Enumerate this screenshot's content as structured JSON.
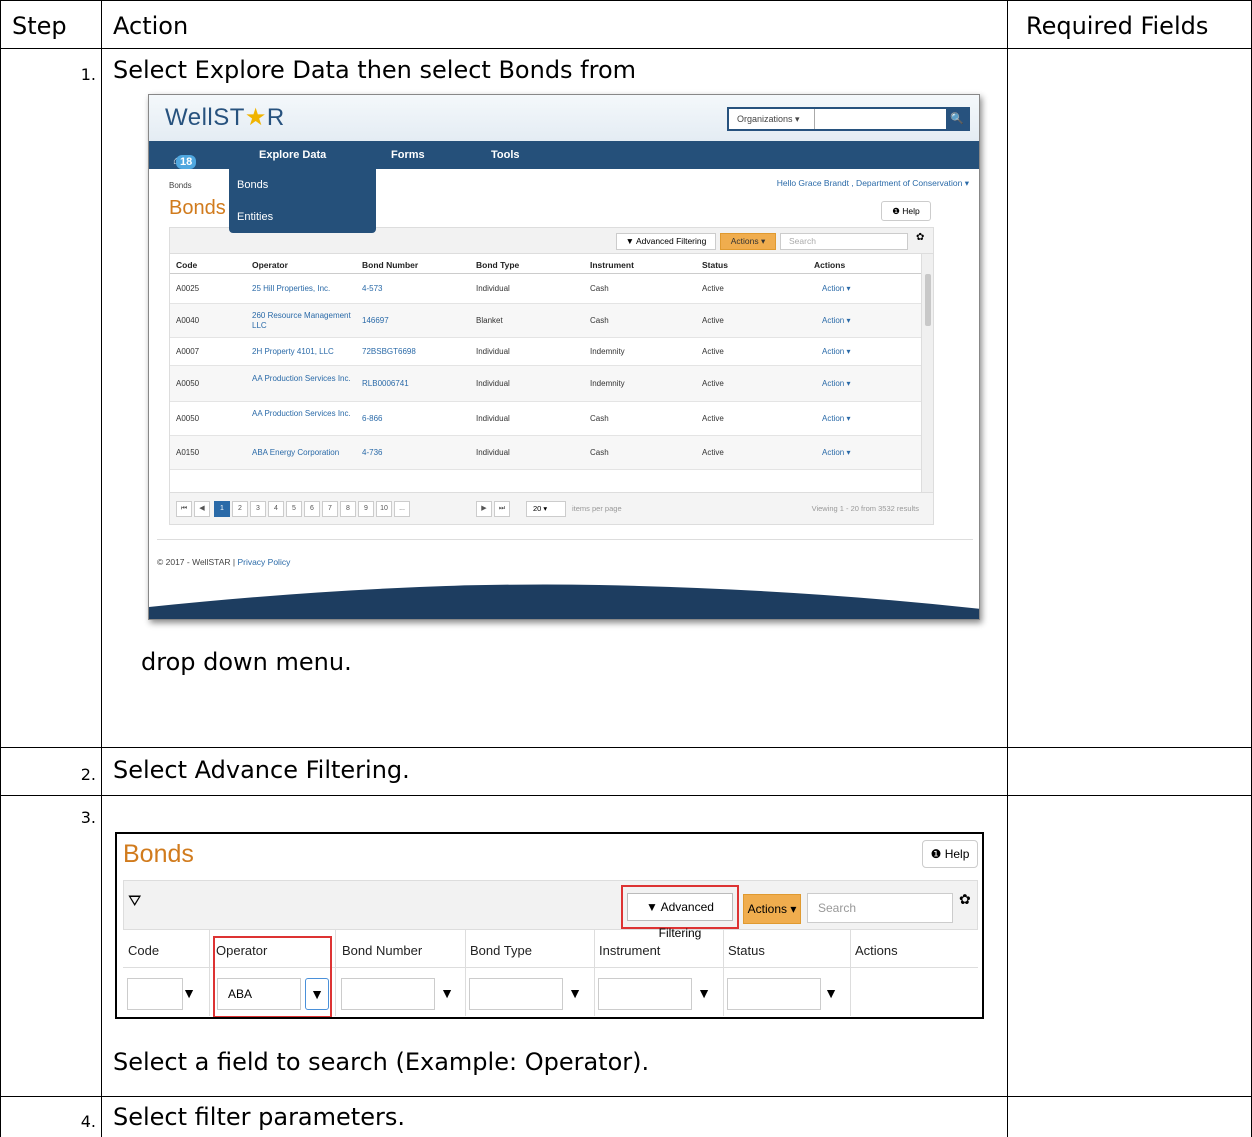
{
  "table": {
    "headers": {
      "step": "Step",
      "action": "Action",
      "required": "Required Fields"
    },
    "rows": [
      {
        "num": "1.",
        "text_before": "Select Explore Data then select Bonds from",
        "text_after": "drop down menu."
      },
      {
        "num": "2.",
        "text": "Select Advance Filtering."
      },
      {
        "num": "3.",
        "text_after": "Select a field to search (Example: Operator)."
      },
      {
        "num": "4.",
        "text": "Select filter parameters."
      }
    ]
  },
  "shot1": {
    "logo": {
      "pre": "Well",
      "mid": "ST",
      "star": "★",
      "post": "R"
    },
    "org_select": "Organizations ▾",
    "search_icon": "🔍",
    "nav": {
      "home": "⌂",
      "badge": "18",
      "explore": "Explore Data",
      "forms": "Forms",
      "tools": "Tools"
    },
    "dropdown": [
      "Bonds",
      "Entities"
    ],
    "breadcrumb": "Bonds",
    "hello": "Hello Grace Brandt , Department of Conservation ▾",
    "title": "Bonds",
    "help": "❶ Help",
    "toolbar": {
      "advanced": "▼ Advanced Filtering",
      "actions": "Actions ▾",
      "search_placeholder": "Search",
      "gear": "✿"
    },
    "columns": [
      "Code",
      "Operator",
      "Bond Number",
      "Bond Type",
      "Instrument",
      "Status",
      "Actions"
    ],
    "rows": [
      {
        "code": "A0025",
        "operator": "25 Hill Properties, Inc.",
        "bond": "4-573",
        "type": "Individual",
        "instrument": "Cash",
        "status": "Active",
        "action": "Action ▾"
      },
      {
        "code": "A0040",
        "operator": "260 Resource Management LLC",
        "bond": "146697",
        "type": "Blanket",
        "instrument": "Cash",
        "status": "Active",
        "action": "Action ▾"
      },
      {
        "code": "A0007",
        "operator": "2H Property 4101, LLC",
        "bond": "72BSBGT6698",
        "type": "Individual",
        "instrument": "Indemnity",
        "status": "Active",
        "action": "Action ▾"
      },
      {
        "code": "A0050",
        "operator": "AA Production Services Inc.",
        "bond": "RLB0006741",
        "type": "Individual",
        "instrument": "Indemnity",
        "status": "Active",
        "action": "Action ▾"
      },
      {
        "code": "A0050",
        "operator": "AA Production Services Inc.",
        "bond": "6-866",
        "type": "Individual",
        "instrument": "Cash",
        "status": "Active",
        "action": "Action ▾"
      },
      {
        "code": "A0150",
        "operator": "ABA Energy Corporation",
        "bond": "4-736",
        "type": "Individual",
        "instrument": "Cash",
        "status": "Active",
        "action": "Action ▾"
      }
    ],
    "pager": {
      "first": "⏮",
      "prev": "◀",
      "pages": [
        "1",
        "2",
        "3",
        "4",
        "5",
        "6",
        "7",
        "8",
        "9",
        "10",
        "..."
      ],
      "next": "▶",
      "last": "⏭",
      "per_page": "20 ▾",
      "items_label": "items per page",
      "viewing": "Viewing 1 - 20 from 3532 results"
    },
    "footer": {
      "copy": "© 2017 - WellSTAR | ",
      "privacy": "Privacy Policy"
    }
  },
  "shot2": {
    "title": "Bonds",
    "help": "❶ Help",
    "filter_icon": "⛛",
    "advanced": "▼ Advanced Filtering",
    "actions": "Actions ▾",
    "search_placeholder": "Search",
    "gear": "✿",
    "columns": [
      "Code",
      "Operator",
      "Bond Number",
      "Bond Type",
      "Instrument",
      "Status",
      "Actions"
    ],
    "operator_value": "ABA",
    "funnel": "▼",
    "highlight_color": "#dd3333"
  }
}
